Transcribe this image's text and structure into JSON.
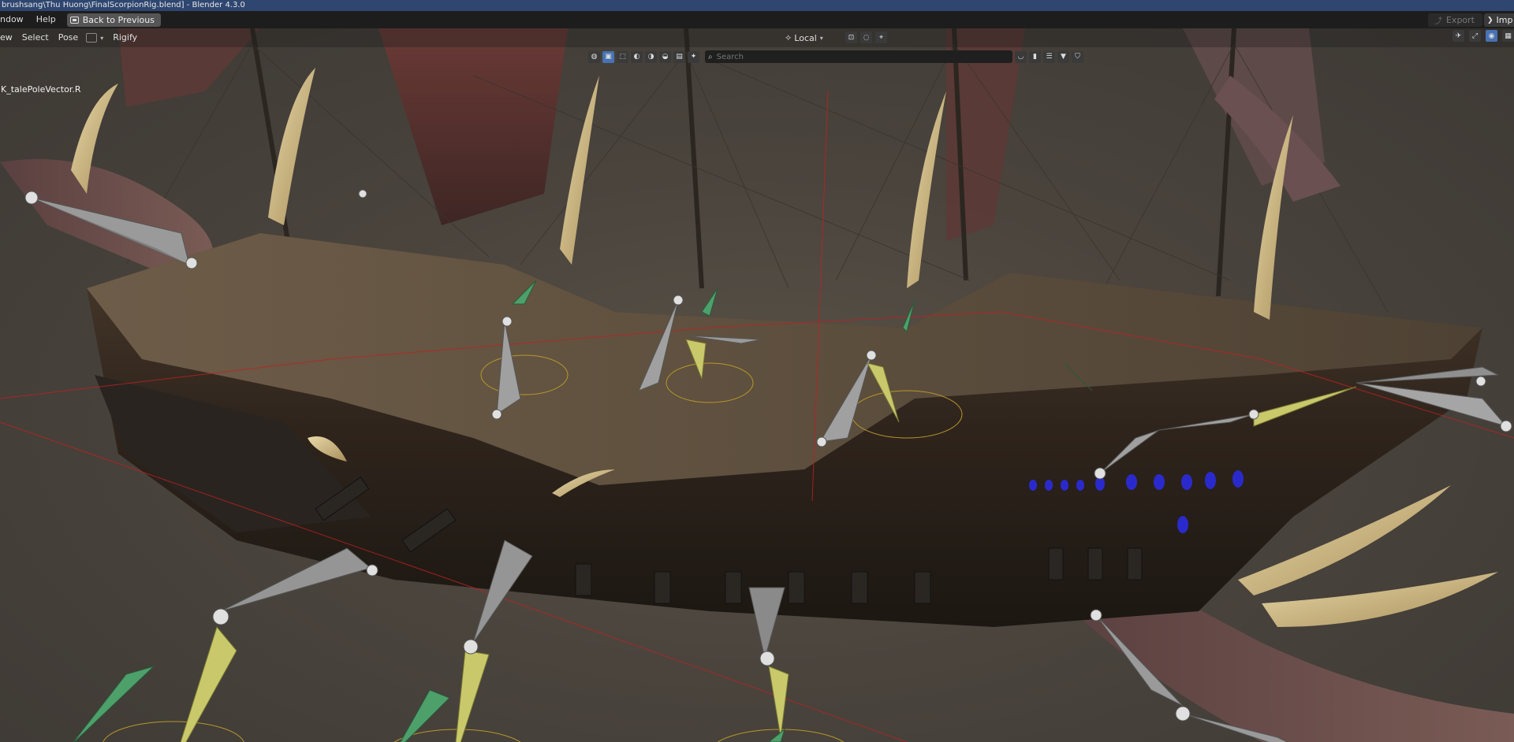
{
  "window": {
    "title": "brushsang\\Thu Huong\\FinalScorpionRig.blend] - Blender 4.3.0"
  },
  "topbar": {
    "menus": [
      "ndow",
      "Help"
    ],
    "back_label": "Back to Previous",
    "export_label": "Export",
    "imp_label": "Imp"
  },
  "header": {
    "menus": [
      "ew",
      "Select",
      "Pose"
    ],
    "rigify_label": "Rigify",
    "pivot_label": "Local"
  },
  "search": {
    "placeholder": "Search"
  },
  "viewport": {
    "active_bone": "K_talePoleVector.R"
  },
  "icons": {
    "back": "screen-icon",
    "export": "export-icon",
    "search": "search-icon",
    "transform_orientation": "orientation-icon",
    "filter": "funnel-icon",
    "bookmark": "bookmark-icon",
    "shield": "shield-icon"
  },
  "colors": {
    "title_bar": "#2e4670",
    "top_bar": "#1d1d1d",
    "active_tool": "#4772b3",
    "bone_grey": "#9a9a9a",
    "bone_green": "#4ea06b",
    "bone_yellow": "#c9c96b"
  }
}
